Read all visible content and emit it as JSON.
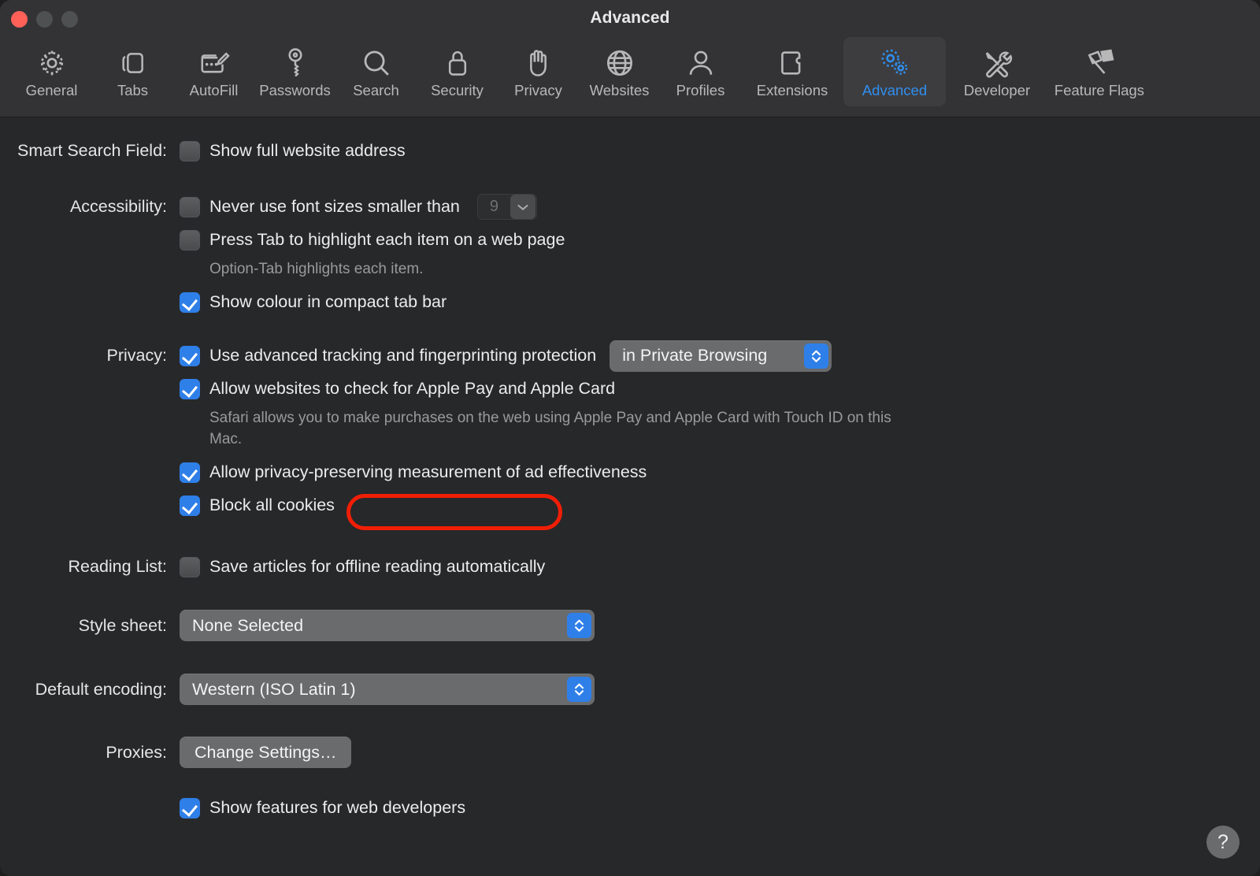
{
  "window": {
    "title": "Advanced",
    "traffic_lights": [
      "close-button",
      "minimize-button",
      "maximize-button"
    ]
  },
  "colors": {
    "accent_blue": "#2f7fe8",
    "selected_tab_label": "#2f8fef",
    "annotation_red": "#f01e06",
    "toolbar_bg": "#333336",
    "content_bg": "#27282a",
    "control_grey": "#6a6b6d"
  },
  "toolbar": {
    "tabs": [
      {
        "label": "General",
        "icon": "gear-icon",
        "selected": false
      },
      {
        "label": "Tabs",
        "icon": "tabs-icon",
        "selected": false
      },
      {
        "label": "AutoFill",
        "icon": "autofill-icon",
        "selected": false
      },
      {
        "label": "Passwords",
        "icon": "key-icon",
        "selected": false
      },
      {
        "label": "Search",
        "icon": "search-icon",
        "selected": false
      },
      {
        "label": "Security",
        "icon": "lock-icon",
        "selected": false
      },
      {
        "label": "Privacy",
        "icon": "hand-icon",
        "selected": false
      },
      {
        "label": "Websites",
        "icon": "globe-icon",
        "selected": false
      },
      {
        "label": "Profiles",
        "icon": "person-icon",
        "selected": false
      },
      {
        "label": "Extensions",
        "icon": "puzzle-icon",
        "selected": false
      },
      {
        "label": "Advanced",
        "icon": "double-gear-icon",
        "selected": true
      },
      {
        "label": "Developer",
        "icon": "tools-icon",
        "selected": false
      },
      {
        "label": "Feature Flags",
        "icon": "flags-icon",
        "selected": false
      }
    ]
  },
  "settings": {
    "smart_search_field": {
      "label": "Smart Search Field:",
      "show_full_address": {
        "label": "Show full website address",
        "checked": false
      }
    },
    "accessibility": {
      "label": "Accessibility:",
      "min_font_size": {
        "label": "Never use font sizes smaller than",
        "checked": false,
        "value": "9",
        "disabled": true
      },
      "press_tab": {
        "label": "Press Tab to highlight each item on a web page",
        "checked": false,
        "hint": "Option-Tab highlights each item."
      },
      "show_colour_tab_bar": {
        "label": "Show colour in compact tab bar",
        "checked": true
      }
    },
    "privacy": {
      "label": "Privacy:",
      "advanced_tracking": {
        "label": "Use advanced tracking and fingerprinting protection",
        "checked": true,
        "scope_value": "in Private Browsing"
      },
      "apple_pay": {
        "label": "Allow websites to check for Apple Pay and Apple Card",
        "checked": true,
        "hint": "Safari allows you to make purchases on the web using Apple Pay and Apple Card with Touch ID on this Mac."
      },
      "ad_measurement": {
        "label": "Allow privacy-preserving measurement of ad effectiveness",
        "checked": true
      },
      "block_cookies": {
        "label": "Block all cookies",
        "checked": true,
        "annotated": true
      }
    },
    "reading_list": {
      "label": "Reading List:",
      "save_offline": {
        "label": "Save articles for offline reading automatically",
        "checked": false
      }
    },
    "style_sheet": {
      "label": "Style sheet:",
      "value": "None Selected"
    },
    "default_encoding": {
      "label": "Default encoding:",
      "value": "Western (ISO Latin 1)"
    },
    "proxies": {
      "label": "Proxies:",
      "button_label": "Change Settings…"
    },
    "developer_features": {
      "label": "Show features for web developers",
      "checked": true
    }
  },
  "help": {
    "glyph": "?",
    "name": "help-button"
  }
}
